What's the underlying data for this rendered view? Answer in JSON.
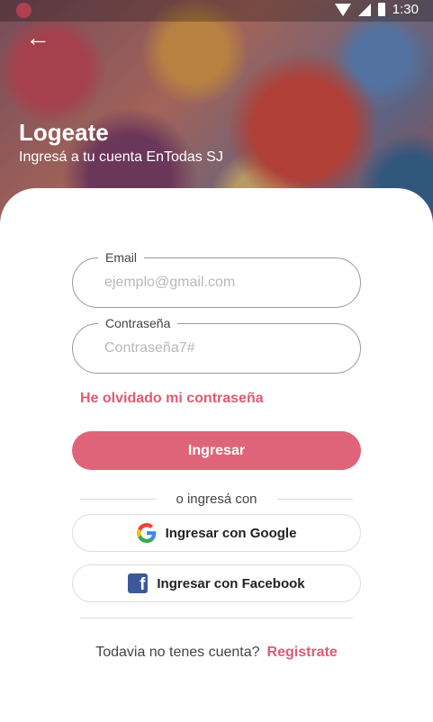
{
  "status_bar": {
    "time": "1:30"
  },
  "header": {
    "back_icon": "arrow-left-icon",
    "title": "Logeate",
    "subtitle": "Ingresá a tu cuenta EnTodas SJ"
  },
  "form": {
    "email": {
      "label": "Email",
      "placeholder": "ejemplo@gmail.com",
      "value": ""
    },
    "password": {
      "label": "Contraseña",
      "placeholder": "Contraseña7#",
      "value": ""
    },
    "forgot_link": "He olvidado mi contraseña",
    "submit_label": "Ingresar",
    "divider_text": "o ingresá con",
    "google_label": "Ingresar con Google",
    "facebook_label": "Ingresar con Facebook",
    "footer_text": "Todavia no tenes cuenta?",
    "register_link": "Registrate"
  },
  "colors": {
    "accent": "#e06479",
    "facebook": "#3b5998"
  }
}
